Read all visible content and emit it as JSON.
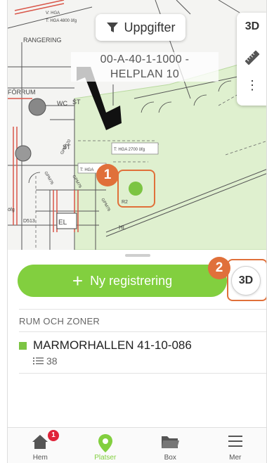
{
  "map": {
    "filter_label": "Uppgifter",
    "plan_title_line1": "00-A-40-1-1000 -",
    "plan_title_line2": "HELPLAN 10",
    "side_3d_label": "3D",
    "side_more_label": "⋮",
    "marker_label": "R2",
    "callout_1": "1",
    "plan_labels": {
      "rangering": "RANGERING",
      "forrum": "FÖRRUM",
      "wc": "WC",
      "st_left": "ST",
      "st_top": "ST",
      "el": "EL",
      "hl": "HL",
      "hga_2700": "T: HGA 2700 öfg",
      "hga": "T: HGA",
      "v_hga": "V: HGA",
      "t_hga_4800": "T: HGA 4800 öfg",
      "gpm_a": "GPM120",
      "gpm_b": "GPM76",
      "gpm_c": "GPM76",
      "gpm_d": "GPM76",
      "ofg": "öfg",
      "d513": "D513"
    }
  },
  "sheet": {
    "new_registration_label": "Ny registrering",
    "btn_3d_label": "3D",
    "callout_2": "2",
    "section_header": "RUM OCH ZONER",
    "room": {
      "name": "MARMORHALLEN 41-10-086",
      "count": "38",
      "color": "#7cc443"
    }
  },
  "tabbar": {
    "items": [
      {
        "label": "Hem",
        "icon": "home-icon",
        "badge": "1"
      },
      {
        "label": "Platser",
        "icon": "location-pin-icon"
      },
      {
        "label": "Box",
        "icon": "folder-icon"
      },
      {
        "label": "Mer",
        "icon": "menu-icon"
      }
    ]
  },
  "colors": {
    "accent_green": "#82cf3f",
    "callout_orange": "#e0703a",
    "notification_red": "#e0243a",
    "zone_fill": "#dff0cf"
  }
}
